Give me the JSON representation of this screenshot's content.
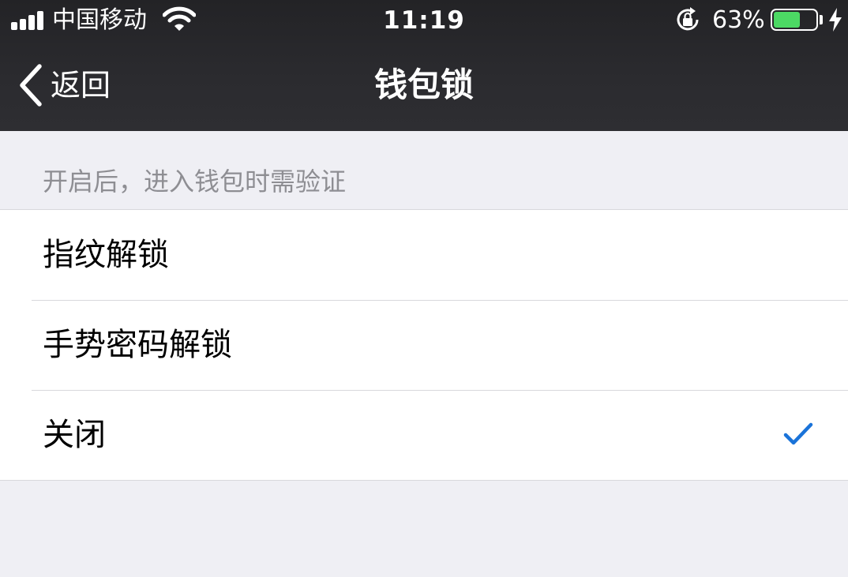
{
  "status_bar": {
    "carrier": "中国移动",
    "time": "11:19",
    "battery_percent_text": "63%",
    "battery_level": 0.63,
    "icons": [
      "signal-bars-icon",
      "wifi-icon",
      "rotation-lock-icon",
      "battery-icon",
      "charging-bolt-icon"
    ],
    "battery_fill_color": "#4cd964"
  },
  "nav": {
    "back_label": "返回",
    "title": "钱包锁"
  },
  "section": {
    "header": "开启后，进入钱包时需验证"
  },
  "options": [
    {
      "label": "指纹解锁",
      "selected": false
    },
    {
      "label": "手势密码解锁",
      "selected": false
    },
    {
      "label": "关闭",
      "selected": true
    }
  ],
  "colors": {
    "accent": "#1a73d9",
    "nav_background": "#2b2b2f",
    "page_background": "#efeff4"
  }
}
